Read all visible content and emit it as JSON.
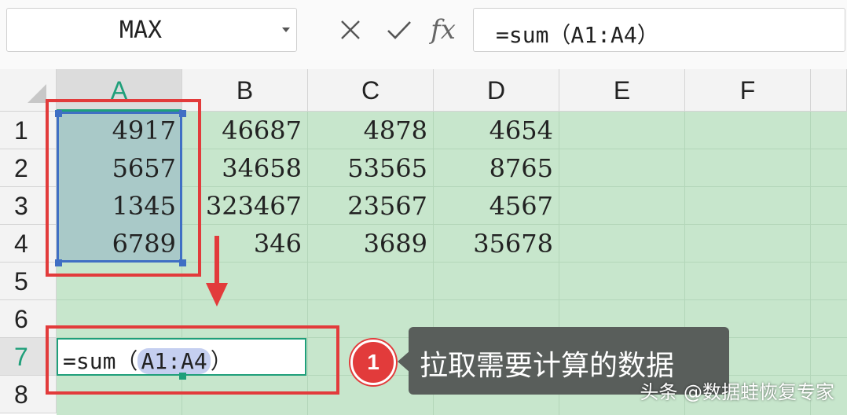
{
  "formula_bar": {
    "name_box": "MAX",
    "cancel_glyph": "×",
    "confirm_glyph": "✓",
    "fx_label": "fx",
    "formula": "=sum（A1:A4）"
  },
  "columns": [
    "A",
    "B",
    "C",
    "D",
    "E",
    "F"
  ],
  "selected_column": "A",
  "rows": [
    "1",
    "2",
    "3",
    "4",
    "5",
    "6",
    "7",
    "8"
  ],
  "selected_row": "7",
  "cells": {
    "r1": [
      "4917",
      "46687",
      "4878",
      "4654"
    ],
    "r2": [
      "5657",
      "34658",
      "53565",
      "8765"
    ],
    "r3": [
      "1345",
      "323467",
      "23567",
      "4567"
    ],
    "r4": [
      "6789",
      "346",
      "3689",
      "35678"
    ]
  },
  "editing_cell": {
    "prefix": "=sum（",
    "reference": "A1:A4",
    "suffix": "）"
  },
  "annotation": {
    "step_number": "1",
    "callout": "拉取需要计算的数据",
    "accent_color": "#e23b3b"
  },
  "watermark": "头条 @数据蛙恢复专家",
  "colors": {
    "sheet_background": "#c7e6cc",
    "selection_fill": "#a9c9c8",
    "selection_border": "#3f6fc4",
    "active_green": "#1f9f7a"
  }
}
